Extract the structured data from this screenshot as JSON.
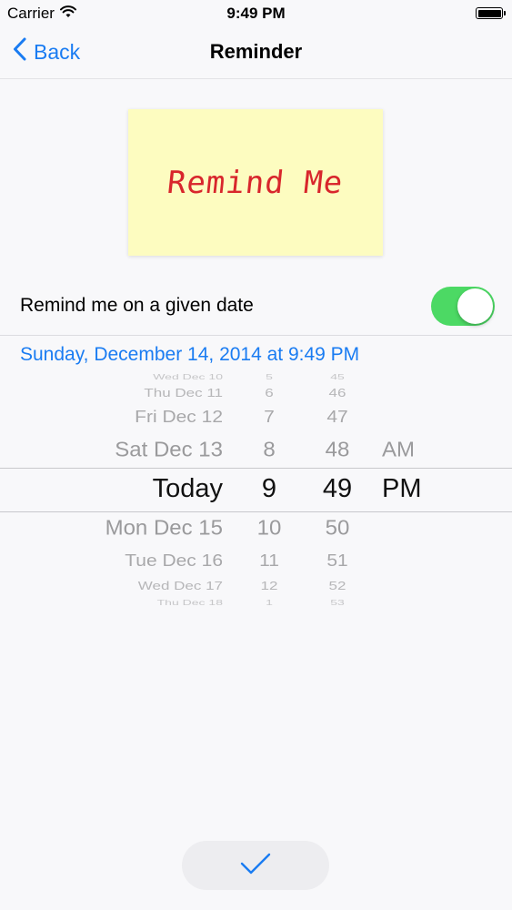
{
  "status_bar": {
    "carrier": "Carrier",
    "time": "9:49 PM",
    "battery_level": 1.0
  },
  "nav": {
    "back_label": "Back",
    "title": "Reminder"
  },
  "note": {
    "text": "Remind Me"
  },
  "reminder_toggle": {
    "label": "Remind me on a given date",
    "on": true
  },
  "selected_date_text": "Sunday, December 14, 2014 at 9:49 PM",
  "picker": {
    "rows": [
      {
        "date": "Wed Dec 10",
        "hour": "5",
        "minute": "45",
        "ampm": ""
      },
      {
        "date": "Thu Dec 11",
        "hour": "6",
        "minute": "46",
        "ampm": ""
      },
      {
        "date": "Fri Dec 12",
        "hour": "7",
        "minute": "47",
        "ampm": ""
      },
      {
        "date": "Sat Dec 13",
        "hour": "8",
        "minute": "48",
        "ampm": "AM"
      },
      {
        "date": "Today",
        "hour": "9",
        "minute": "49",
        "ampm": "PM"
      },
      {
        "date": "Mon Dec 15",
        "hour": "10",
        "minute": "50",
        "ampm": ""
      },
      {
        "date": "Tue Dec 16",
        "hour": "11",
        "minute": "51",
        "ampm": ""
      },
      {
        "date": "Wed Dec 17",
        "hour": "12",
        "minute": "52",
        "ampm": ""
      },
      {
        "date": "Thu Dec 18",
        "hour": "1",
        "minute": "53",
        "ampm": ""
      }
    ],
    "selected_index": 4
  },
  "confirm": {
    "icon": "checkmark-icon"
  },
  "colors": {
    "accent": "#1a7cf2",
    "toggle_on": "#4cd964",
    "note_background": "#fdfcc0",
    "note_text": "#d8262c",
    "background": "#f8f8fa"
  }
}
